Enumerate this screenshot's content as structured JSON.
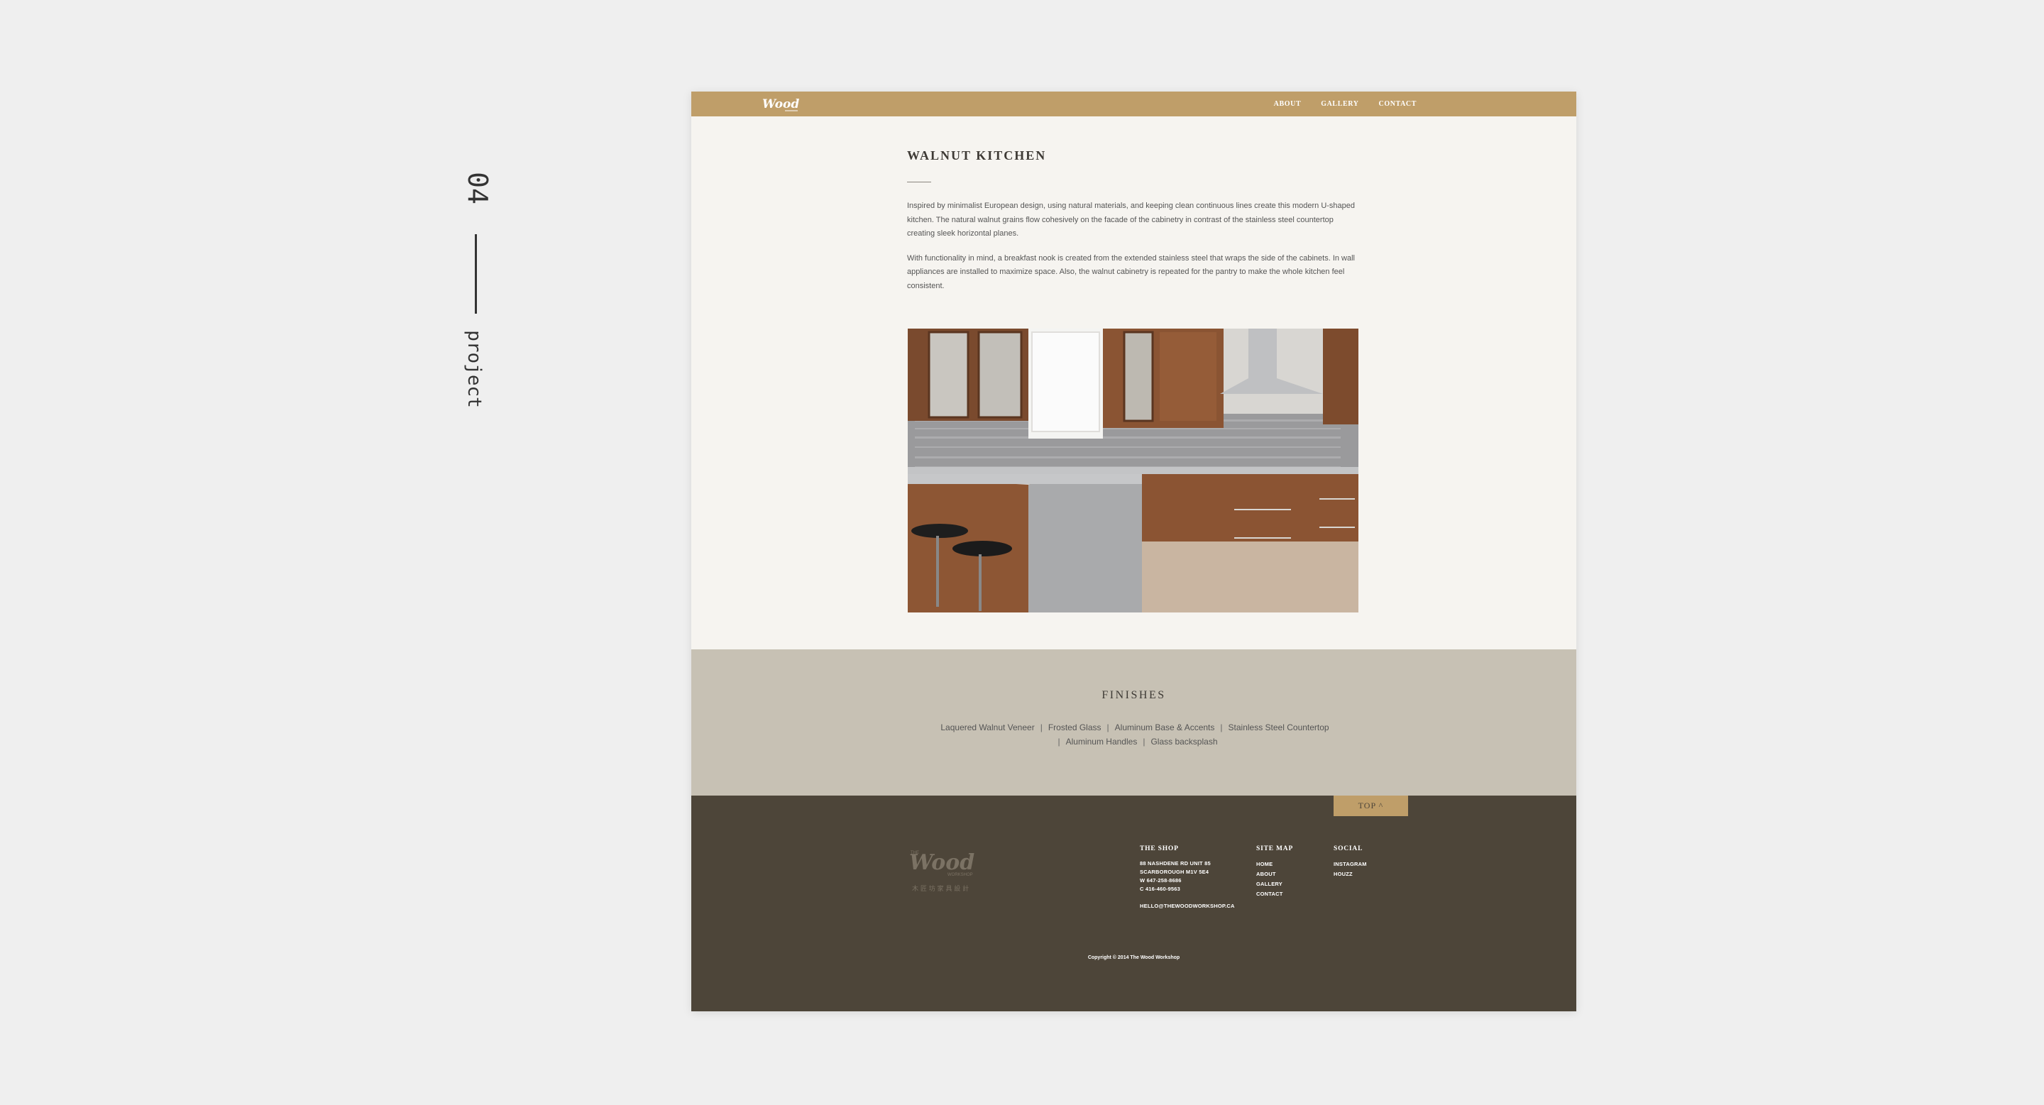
{
  "side_label": {
    "number": "04",
    "word": "project"
  },
  "nav": {
    "logo_text": "Wood",
    "links": [
      "ABOUT",
      "GALLERY",
      "CONTACT"
    ]
  },
  "project": {
    "title": "WALNUT KITCHEN",
    "paragraphs": [
      "Inspired by minimalist European design, using natural materials, and keeping clean continuous lines create this modern U-shaped kitchen. The natural walnut grains flow cohesively on the facade of the cabinetry in contrast of the stainless steel countertop creating sleek horizontal planes.",
      "With functionality in mind, a breakfast nook is created from the extended stainless steel that wraps the side of the cabinets. In wall appliances are installed to maximize space. Also, the walnut cabinetry is repeated for the pantry to make the whole kitchen feel consistent."
    ]
  },
  "finishes": {
    "title": "FINISHES",
    "items": [
      "Laquered Walnut Veneer",
      "Frosted Glass",
      "Aluminum Base & Accents",
      "Stainless Steel Countertop",
      "Aluminum Handles",
      "Glass backsplash"
    ],
    "separator": "|"
  },
  "footer": {
    "top_button": "TOP ^",
    "logo": {
      "small_top": "THE",
      "main": "Wood",
      "small_bottom": "WORKSHOP",
      "chinese": "木 匠 坊 家 具 設 計"
    },
    "shop": {
      "heading": "THE SHOP",
      "lines": [
        "88 NASHDENE RD     UNIT 85",
        "SCARBOROUGH     M1V 5E4",
        "W     647-258-8686",
        "C     416-460-9563"
      ],
      "email": "HELLO@THEWOODWORKSHOP.CA"
    },
    "sitemap": {
      "heading": "SITE MAP",
      "links": [
        "HOME",
        "ABOUT",
        "GALLERY",
        "CONTACT"
      ]
    },
    "social": {
      "heading": "SOCIAL",
      "links": [
        "INSTAGRAM",
        "HOUZZ"
      ]
    },
    "copyright": "Copyright © 2014 The Wood Workshop"
  },
  "colors": {
    "page_bg": "#efefef",
    "nav_gold": "#bf9e69",
    "content_bg": "#f6f4f0",
    "finishes_bg": "#c7c1b4",
    "footer_bg": "#4d4539"
  }
}
